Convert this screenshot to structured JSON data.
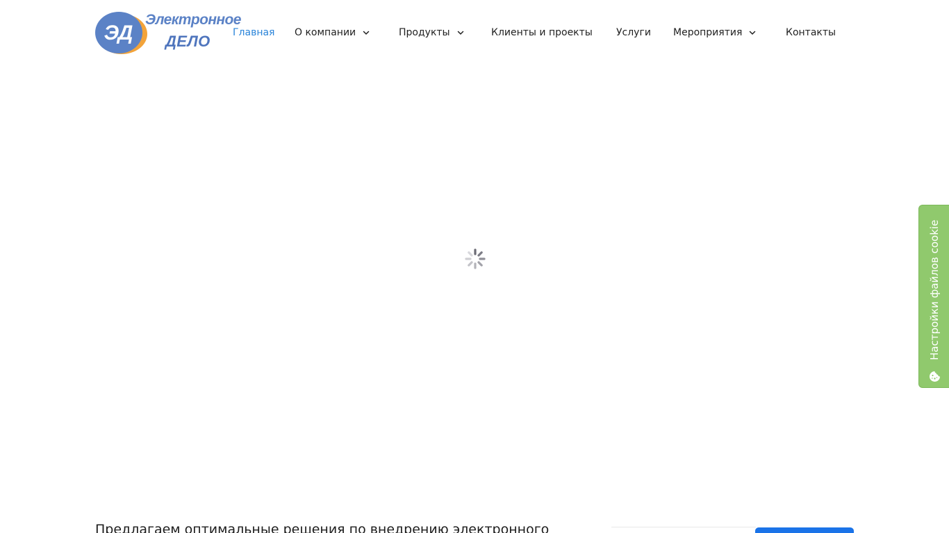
{
  "logo": {
    "line1": "Электронное",
    "line2": "ДЕЛО",
    "mark": "ЭД"
  },
  "nav": {
    "items": [
      {
        "label": "Главная",
        "active": true,
        "dropdown": false
      },
      {
        "label": "О компании",
        "active": false,
        "dropdown": true
      },
      {
        "label": "Продукты",
        "active": false,
        "dropdown": true
      },
      {
        "label": "Клиенты и проекты",
        "active": false,
        "dropdown": false
      },
      {
        "label": "Услуги",
        "active": false,
        "dropdown": false
      },
      {
        "label": "Мероприятия",
        "active": false,
        "dropdown": true
      },
      {
        "label": "Контакты",
        "active": false,
        "dropdown": false
      }
    ]
  },
  "cookie_settings": {
    "label": "Настройки файлов cookie",
    "icon": "cookie-icon"
  },
  "hero": {
    "tagline": "Предлагаем оптимальные решения по внедрению электронного"
  },
  "colors": {
    "accent": "#2a84d9",
    "logo_blue": "#5b82c6",
    "logo_orange": "#f2a33a",
    "cookie_green": "#90c96d",
    "cta_blue": "#1a73e8"
  }
}
